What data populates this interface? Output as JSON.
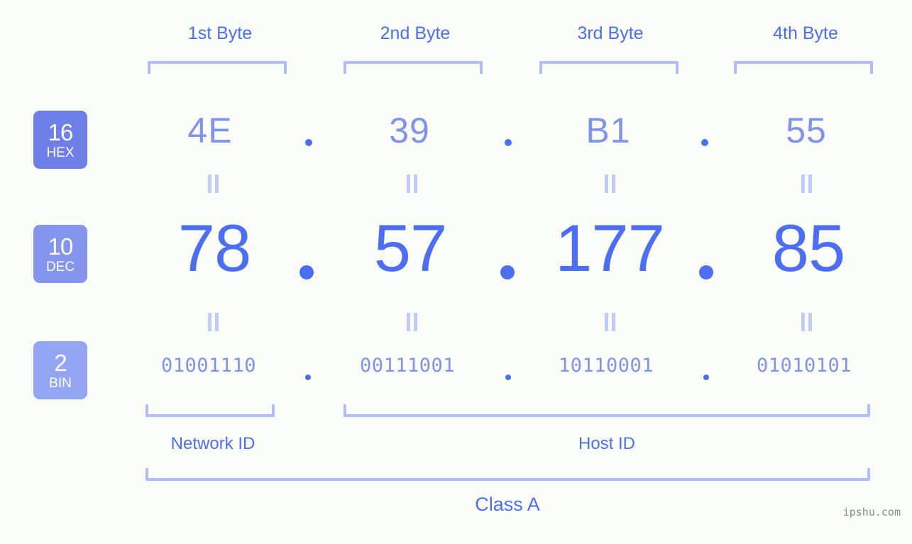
{
  "header": {
    "byte_labels": [
      "1st Byte",
      "2nd Byte",
      "3rd Byte",
      "4th Byte"
    ]
  },
  "bases": [
    {
      "number": "16",
      "abbr": "HEX"
    },
    {
      "number": "10",
      "abbr": "DEC"
    },
    {
      "number": "2",
      "abbr": "BIN"
    }
  ],
  "rows": {
    "hex": {
      "base_number": "16",
      "base_abbr": "HEX",
      "octets": [
        "4E",
        "39",
        "B1",
        "55"
      ],
      "separator": "."
    },
    "dec": {
      "base_number": "10",
      "base_abbr": "DEC",
      "octets": [
        "78",
        "57",
        "177",
        "85"
      ],
      "separator": "."
    },
    "bin": {
      "base_number": "2",
      "base_abbr": "BIN",
      "octets": [
        "01001110",
        "00111001",
        "10110001",
        "01010101"
      ],
      "separator": "."
    }
  },
  "equivalence_marks": [
    "=",
    "=",
    "=",
    "=",
    "=",
    "=",
    "=",
    "="
  ],
  "sections": {
    "network_id": "Network ID",
    "host_id": "Host ID",
    "ip_class": "Class A"
  },
  "watermark": "ipshu.com",
  "colors": {
    "background": "#fbfdf8",
    "accent_strong": "#4e6ef2",
    "accent_medium": "#8193e8",
    "accent_light": "#b3bdf7",
    "badge_hex": "#6f7fe8",
    "badge_dec": "#8595ee",
    "badge_bin": "#94a5f4",
    "watermark": "#8a8a8a"
  }
}
